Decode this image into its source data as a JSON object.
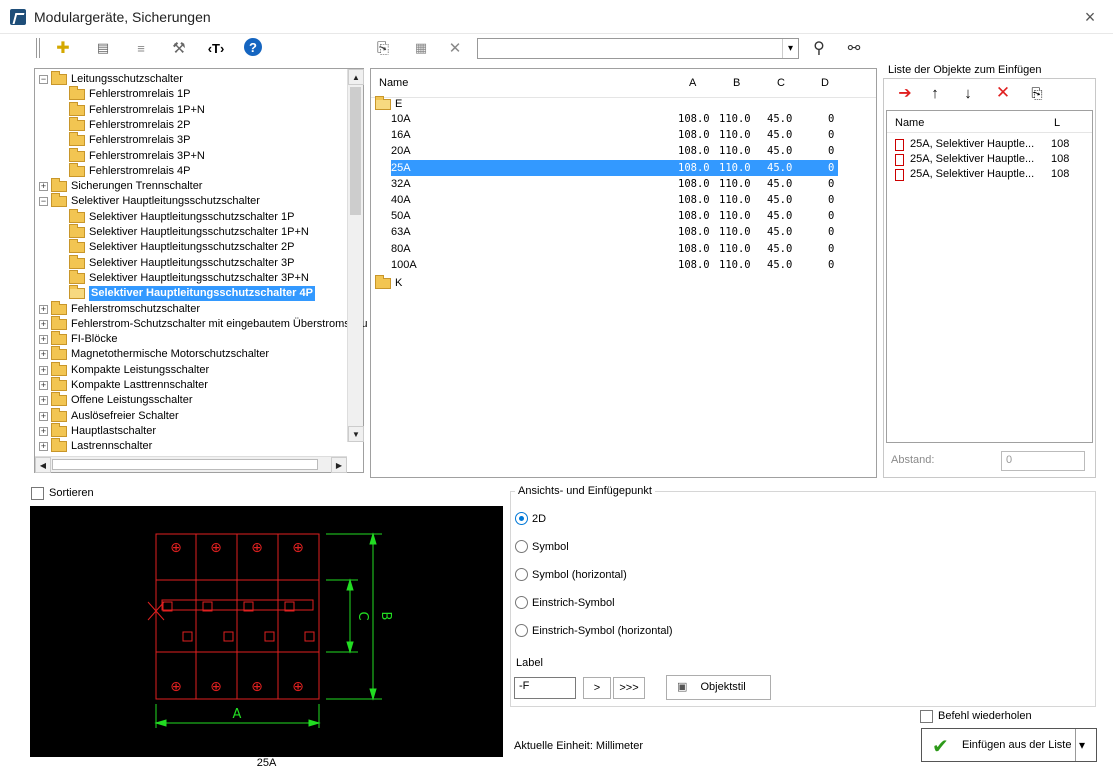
{
  "window": {
    "title": "Modulargeräte, Sicherungen",
    "close": "×"
  },
  "toolbar_left": {
    "add": "✚",
    "b2": "▤",
    "b3": "≡",
    "tools": "⚒",
    "text": "‹T›",
    "help": "?"
  },
  "toolbar_mid": {
    "copy": "⎘",
    "b2": "▦",
    "delete": "✕",
    "search_value": "",
    "dropdown": "▾",
    "search": "⚲",
    "find": "⚯"
  },
  "tree": {
    "items": [
      {
        "label": "Leitungsschutzschalter",
        "level": 0,
        "pm": "−"
      },
      {
        "label": "Fehlerstromrelais 1P",
        "level": 1
      },
      {
        "label": "Fehlerstromrelais 1P+N",
        "level": 1
      },
      {
        "label": "Fehlerstromrelais 2P",
        "level": 1
      },
      {
        "label": "Fehlerstromrelais 3P",
        "level": 1
      },
      {
        "label": "Fehlerstromrelais 3P+N",
        "level": 1
      },
      {
        "label": "Fehlerstromrelais 4P",
        "level": 1
      },
      {
        "label": "Sicherungen Trennschalter",
        "level": 0,
        "pm": "+"
      },
      {
        "label": "Selektiver Hauptleitungsschutzschalter",
        "level": 0,
        "pm": "−"
      },
      {
        "label": "Selektiver Hauptleitungsschutzschalter 1P",
        "level": 1
      },
      {
        "label": "Selektiver Hauptleitungsschutzschalter 1P+N",
        "level": 1
      },
      {
        "label": "Selektiver Hauptleitungsschutzschalter 2P",
        "level": 1
      },
      {
        "label": "Selektiver Hauptleitungsschutzschalter 3P",
        "level": 1
      },
      {
        "label": "Selektiver Hauptleitungsschutzschalter 3P+N",
        "level": 1
      },
      {
        "label": "Selektiver Hauptleitungsschutzschalter 4P",
        "level": 1,
        "selected": true
      },
      {
        "label": "Fehlerstromschutzschalter",
        "level": 0,
        "pm": "+"
      },
      {
        "label": "Fehlerstrom-Schutzschalter mit eingebautem Überstromschu",
        "level": 0,
        "pm": "+"
      },
      {
        "label": "FI-Blöcke",
        "level": 0,
        "pm": "+"
      },
      {
        "label": "Magnetothermische Motorschutzschalter",
        "level": 0,
        "pm": "+"
      },
      {
        "label": "Kompakte Leistungsschalter",
        "level": 0,
        "pm": "+"
      },
      {
        "label": "Kompakte Lasttrennschalter",
        "level": 0,
        "pm": "+"
      },
      {
        "label": "Offene Leistungsschalter",
        "level": 0,
        "pm": "+"
      },
      {
        "label": "Auslösefreier Schalter",
        "level": 0,
        "pm": "+"
      },
      {
        "label": "Hauptlastschalter",
        "level": 0,
        "pm": "+"
      },
      {
        "label": "Lastrennschalter",
        "level": 0,
        "pm": "+"
      }
    ],
    "scroll_up": "▲",
    "scroll_down": "▼",
    "scroll_left": "◀",
    "scroll_right": "▶"
  },
  "list": {
    "columns": [
      "Name",
      "A",
      "B",
      "C",
      "D"
    ],
    "group_e": "E",
    "group_k": "K",
    "rows": [
      {
        "name": "10A",
        "a": "108.0",
        "b": "110.0",
        "c": "45.0",
        "d": "0"
      },
      {
        "name": "16A",
        "a": "108.0",
        "b": "110.0",
        "c": "45.0",
        "d": "0"
      },
      {
        "name": "20A",
        "a": "108.0",
        "b": "110.0",
        "c": "45.0",
        "d": "0"
      },
      {
        "name": "25A",
        "a": "108.0",
        "b": "110.0",
        "c": "45.0",
        "d": "0",
        "selected": true
      },
      {
        "name": "32A",
        "a": "108.0",
        "b": "110.0",
        "c": "45.0",
        "d": "0"
      },
      {
        "name": "40A",
        "a": "108.0",
        "b": "110.0",
        "c": "45.0",
        "d": "0"
      },
      {
        "name": "50A",
        "a": "108.0",
        "b": "110.0",
        "c": "45.0",
        "d": "0"
      },
      {
        "name": "63A",
        "a": "108.0",
        "b": "110.0",
        "c": "45.0",
        "d": "0"
      },
      {
        "name": "80A",
        "a": "108.0",
        "b": "110.0",
        "c": "45.0",
        "d": "0"
      },
      {
        "name": "100A",
        "a": "108.0",
        "b": "110.0",
        "c": "45.0",
        "d": "0"
      }
    ]
  },
  "insert_list": {
    "title": "Liste der Objekte zum Einfügen",
    "btn_insert": "➔",
    "btn_up": "↑",
    "btn_down": "↓",
    "btn_delete": "✕",
    "btn_copy": "⎘",
    "col_name": "Name",
    "col_l": "L",
    "rows": [
      {
        "name": "25A, Selektiver Hauptle...",
        "l": "108"
      },
      {
        "name": "25A, Selektiver Hauptle...",
        "l": "108"
      },
      {
        "name": "25A, Selektiver Hauptle...",
        "l": "108"
      }
    ],
    "spacing_label": "Abstand:",
    "spacing_value": "0"
  },
  "sort": {
    "label": "Sortieren"
  },
  "preview": {
    "caption": "25A",
    "dim_a": "A",
    "dim_b": "B",
    "dim_c": "C",
    "plus": "⊕"
  },
  "view": {
    "group_label": "Ansichts- und Einfügepunkt",
    "options": [
      "2D",
      "Symbol",
      "Symbol (horizontal)",
      "Einstrich-Symbol",
      "Einstrich-Symbol (horizontal)"
    ],
    "selected_index": 0,
    "label_caption": "Label",
    "label_value": "-F",
    "btn_next": ">",
    "btn_all": ">>>",
    "btn_style": "Objektstil",
    "style_icon": "▣"
  },
  "footer": {
    "unit": "Aktuelle Einheit: Millimeter",
    "repeat": "Befehl wiederholen",
    "insert": "Einfügen aus der Liste",
    "check": "✔",
    "dropdown": "▾"
  },
  "colors": {
    "accent": "#3399ff",
    "cad_red": "#e02020",
    "cad_green": "#22dd22"
  }
}
